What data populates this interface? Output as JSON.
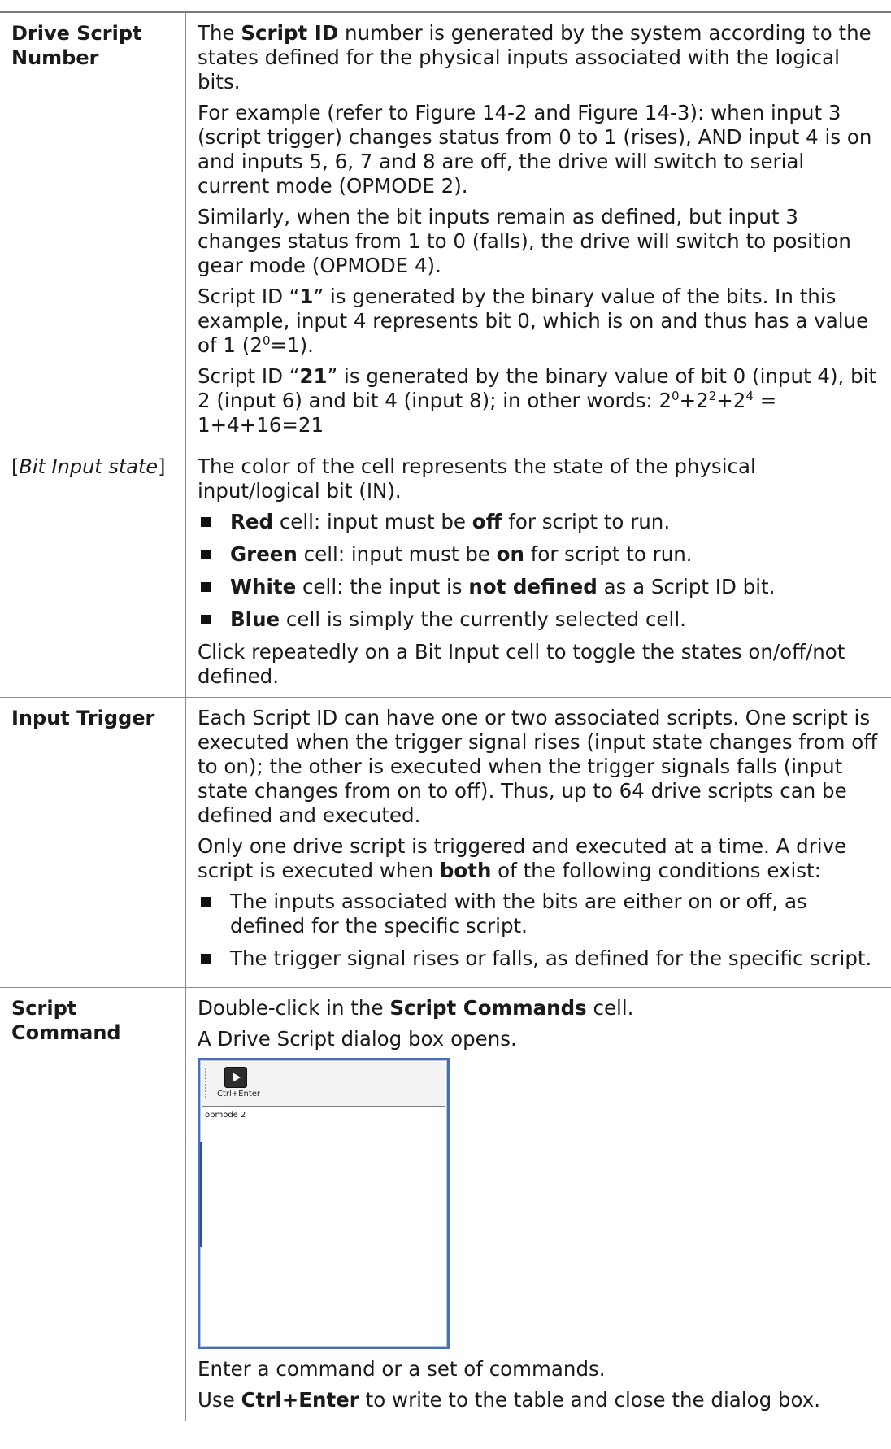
{
  "rows": [
    {
      "term": "Drive Script Number",
      "paragraphs": {
        "p1": {
          "a": "The ",
          "b": "Script ID",
          "c": " number is generated by the system according to the states defined for the physical inputs associated with the logical bits."
        },
        "p2": "For example (refer to Figure 14-2 and Figure 14-3): when input 3 (script trigger) changes status from 0 to 1 (rises), AND input 4 is on and inputs 5, 6, 7 and 8 are off, the drive will switch to serial current mode (OPMODE 2).",
        "p3": "Similarly, when the bit inputs remain as defined, but input 3 changes status from 1 to 0 (falls), the drive will switch to position gear mode (OPMODE 4).",
        "p4": {
          "a": "Script ID “",
          "b": "1",
          "c": "” is generated by the binary value of the bits. In this example, input 4 represents bit 0, which is on and thus has a value of 1 (2",
          "sup": "0",
          "d": "=1)."
        },
        "p5": {
          "a": "Script ID “",
          "b": "21",
          "c": "” is generated by the binary value of bit 0 (input 4), bit 2 (input 6) and bit 4 (input 8); in other words:  2",
          "s1": "0",
          "d": "+2",
          "s2": "2",
          "e": "+2",
          "s3": "4",
          "f": " = 1+4+16=21"
        }
      }
    },
    {
      "term_open": "[",
      "term_italic": "Bit Input state",
      "term_close": "]",
      "intro": "The color of the cell represents the state of the physical input/logical bit (IN).",
      "bullets": [
        {
          "b1": "Red",
          "t1": " cell: input must be ",
          "b2": "off",
          "t2": " for script to run."
        },
        {
          "b1": "Green",
          "t1": " cell: input must be ",
          "b2": "on",
          "t2": " for script to run."
        },
        {
          "b1": "White",
          "t1": " cell: the input is ",
          "b2": "not defined",
          "t2": " as a Script ID bit."
        },
        {
          "b1": "Blue",
          "t1": " cell is simply the currently selected cell.",
          "b2": "",
          "t2": ""
        }
      ],
      "outro": "Click repeatedly on a Bit Input cell to toggle the states on/off/not defined."
    },
    {
      "term": "Input Trigger",
      "p1": "Each Script ID can have one or two associated scripts. One script is executed when the trigger signal rises (input state changes from off to on); the other is executed when the trigger signals falls (input state changes from on to off). Thus, up to 64 drive scripts can be defined and executed.",
      "p2": {
        "a": "Only one drive script is triggered and executed at a time. A drive script is executed when ",
        "b": "both",
        "c": " of the following conditions exist:"
      },
      "bullets": [
        "The inputs associated with the bits are either on or off, as defined for the specific script.",
        "The trigger signal rises or falls, as defined for the specific script."
      ]
    },
    {
      "term": "Script Command",
      "p1": {
        "a": "Double-click in the ",
        "b": "Script Commands",
        "c": " cell."
      },
      "p2": "A Drive Script dialog box opens.",
      "dialog": {
        "run_label": "Ctrl+Enter",
        "editor_text": "opmode 2"
      },
      "p3": "Enter a command or a set of commands.",
      "p4": {
        "a": "Use ",
        "b": "Ctrl+Enter",
        "c": " to write to the table and close the dialog box."
      }
    }
  ]
}
